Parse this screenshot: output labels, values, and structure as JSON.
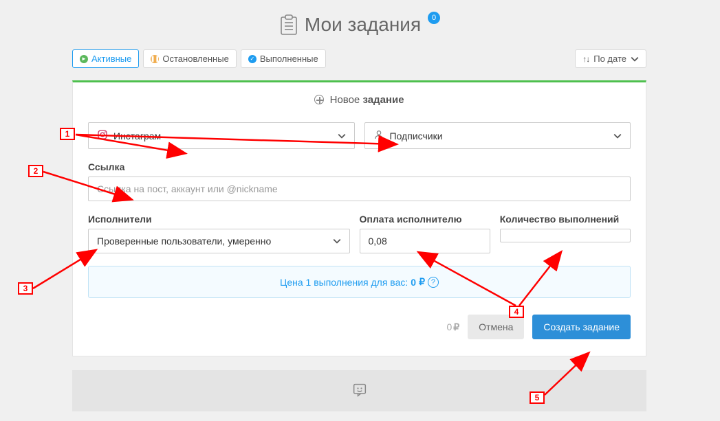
{
  "page": {
    "title": "Мои задания",
    "badge_count": "0"
  },
  "filters": {
    "active": "Активные",
    "paused": "Остановленные",
    "done": "Выполненные",
    "sort": "По дате"
  },
  "new_task": {
    "header_thin": "Новое",
    "header_bold": "задание",
    "network_select": "Инстаграм",
    "type_select": "Подписчики",
    "link_label": "Ссылка",
    "link_placeholder": "Ссылка на пост, аккаунт или @nickname",
    "executors_label": "Исполнители",
    "executors_select": "Проверенные пользователи, умеренно",
    "pay_label": "Оплата исполнителю",
    "pay_value": "0,08",
    "qty_label": "Количество выполнений",
    "qty_value": "",
    "price_banner_prefix": "Цена 1 выполнения для вас:",
    "price_banner_value": "0",
    "total_cost": "0",
    "cancel": "Отмена",
    "create": "Создать задание"
  },
  "annotations": {
    "n1": "1",
    "n2": "2",
    "n3": "3",
    "n4": "4",
    "n5": "5"
  }
}
